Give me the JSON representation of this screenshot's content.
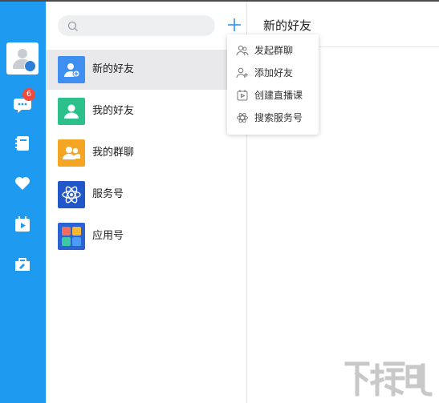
{
  "colors": {
    "sidebar": "#1e9bf0",
    "badge": "#f04a3c",
    "accent": "#2d93e8"
  },
  "sidebar": {
    "items": [
      {
        "name": "chat",
        "icon": "chat-bubble-icon",
        "badge": "6"
      },
      {
        "name": "contacts",
        "icon": "address-book-icon"
      },
      {
        "name": "favorites",
        "icon": "heart-icon"
      },
      {
        "name": "live",
        "icon": "calendar-play-icon"
      },
      {
        "name": "tools",
        "icon": "toolbox-icon"
      }
    ]
  },
  "search": {
    "placeholder": "",
    "icon": "search-icon"
  },
  "add_button": {
    "icon": "plus-icon"
  },
  "contacts": [
    {
      "label": "新的好友",
      "icon": "new-friend-icon",
      "color": "#3f8ff0",
      "active": true
    },
    {
      "label": "我的好友",
      "icon": "friend-icon",
      "color": "#2cc08a"
    },
    {
      "label": "我的群聊",
      "icon": "group-chat-icon",
      "color": "#f5a524"
    },
    {
      "label": "服务号",
      "icon": "atom-icon",
      "color": "#2257c9"
    },
    {
      "label": "应用号",
      "icon": "app-grid-icon",
      "color": "#2b63d3"
    }
  ],
  "main": {
    "title": "新的好友"
  },
  "dropdown": {
    "items": [
      {
        "label": "发起群聊",
        "icon": "group-chat-outline-icon"
      },
      {
        "label": "添加好友",
        "icon": "add-friend-outline-icon"
      },
      {
        "label": "创建直播课",
        "icon": "live-class-outline-icon"
      },
      {
        "label": "搜索服务号",
        "icon": "service-search-outline-icon"
      }
    ]
  },
  "watermark": {
    "text": "下载吧"
  }
}
